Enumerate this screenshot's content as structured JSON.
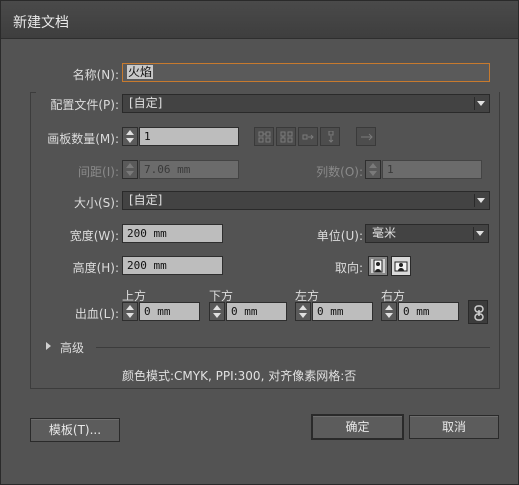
{
  "window": {
    "title": "新建文档"
  },
  "name": {
    "label": "名称(N):",
    "value": "火焰"
  },
  "profile": {
    "label": "配置文件(P):",
    "value": "[自定]"
  },
  "artboards": {
    "label": "画板数量(M):",
    "value": "1"
  },
  "spacing": {
    "label": "间距(I):",
    "value": "7.06 mm"
  },
  "columns": {
    "label": "列数(O):",
    "value": "1"
  },
  "size": {
    "label": "大小(S):",
    "value": "[自定]"
  },
  "width": {
    "label": "宽度(W):",
    "value": "200 mm"
  },
  "units": {
    "label": "单位(U):",
    "value": "毫米"
  },
  "height": {
    "label": "高度(H):",
    "value": "200 mm"
  },
  "orientation": {
    "label": "取向:",
    "selected": "portrait"
  },
  "bleed": {
    "label": "出血(L):",
    "top": {
      "label": "上方",
      "value": "0 mm"
    },
    "bottom": {
      "label": "下方",
      "value": "0 mm"
    },
    "left": {
      "label": "左方",
      "value": "0 mm"
    },
    "right": {
      "label": "右方",
      "value": "0 mm"
    }
  },
  "advanced": {
    "label": "高级"
  },
  "info": {
    "text": "颜色模式:CMYK, PPI:300, 对齐像素网格:否"
  },
  "buttons": {
    "templates": "模板(T)...",
    "ok": "确定",
    "cancel": "取消"
  },
  "colors": {
    "accent": "#c77a2e",
    "background": "#535353"
  }
}
